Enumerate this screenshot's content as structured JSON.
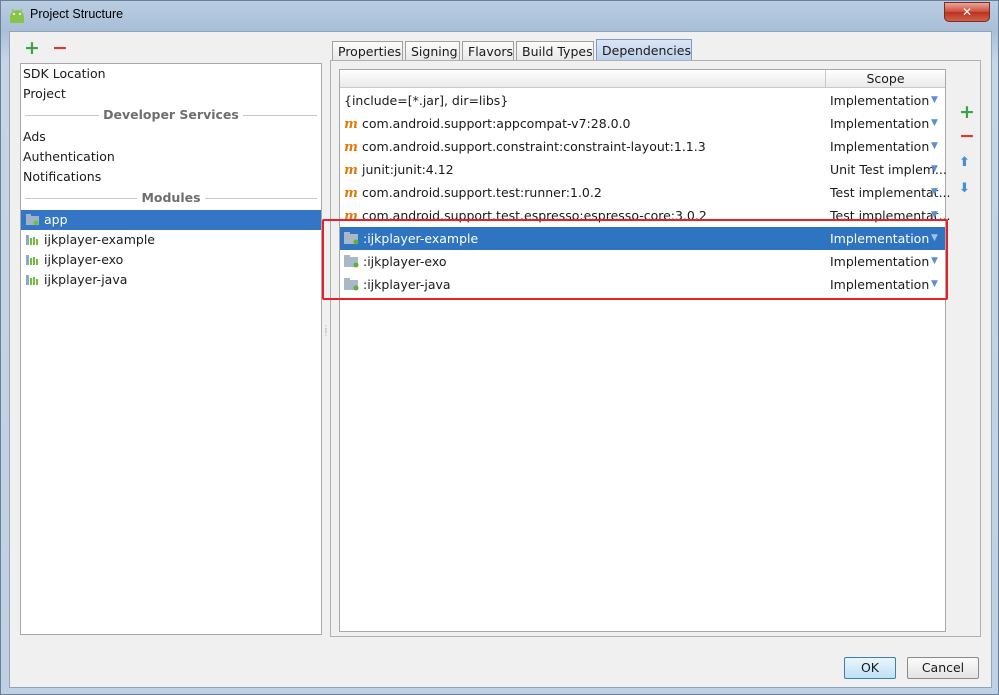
{
  "window": {
    "title": "Project Structure",
    "close_label": "✕"
  },
  "left": {
    "add_label": "+",
    "remove_label": "−",
    "top_items": [
      "SDK Location",
      "Project"
    ],
    "developer_services_header": "Developer Services",
    "services": [
      "Ads",
      "Authentication",
      "Notifications"
    ],
    "modules_header": "Modules",
    "modules": [
      "app",
      "ijkplayer-example",
      "ijkplayer-exo",
      "ijkplayer-java"
    ],
    "selected_module": "app"
  },
  "tabs": [
    "Properties",
    "Signing",
    "Flavors",
    "Build Types",
    "Dependencies"
  ],
  "active_tab": "Dependencies",
  "table": {
    "scope_header": "Scope",
    "rows": [
      {
        "icon": "none",
        "name": "{include=[*.jar], dir=libs}",
        "scope": "Implementation"
      },
      {
        "icon": "maven-icon",
        "icon_glyph": "m",
        "name": "com.android.support:appcompat-v7:28.0.0",
        "scope": "Implementation"
      },
      {
        "icon": "maven-icon",
        "icon_glyph": "m",
        "name": "com.android.support.constraint:constraint-layout:1.1.3",
        "scope": "Implementation"
      },
      {
        "icon": "maven-icon",
        "icon_glyph": "m",
        "name": "junit:junit:4.12",
        "scope": "Unit Test implem..."
      },
      {
        "icon": "maven-icon",
        "icon_glyph": "m",
        "name": "com.android.support.test:runner:1.0.2",
        "scope": "Test implementat..."
      },
      {
        "icon": "maven-icon",
        "icon_glyph": "m",
        "name": "com.android.support.test.espresso:espresso-core:3.0.2",
        "scope": "Test implementat..."
      },
      {
        "icon": "module-folder-icon",
        "name": ":ijkplayer-example",
        "scope": "Implementation",
        "selected": true
      },
      {
        "icon": "module-folder-icon",
        "name": ":ijkplayer-exo",
        "scope": "Implementation"
      },
      {
        "icon": "module-folder-icon",
        "name": ":ijkplayer-java",
        "scope": "Implementation"
      }
    ],
    "dropdown_glyph": "▼"
  },
  "side_toolbar": {
    "add": "+",
    "remove": "−",
    "up": "⬆",
    "down": "⬇"
  },
  "buttons": {
    "ok": "OK",
    "cancel": "Cancel"
  },
  "colors": {
    "selection": "#2f74c0",
    "highlight_box": "#e8202a",
    "maven_icon": "#e07a10",
    "add_green": "#3aa34a",
    "remove_red": "#d0402f"
  }
}
